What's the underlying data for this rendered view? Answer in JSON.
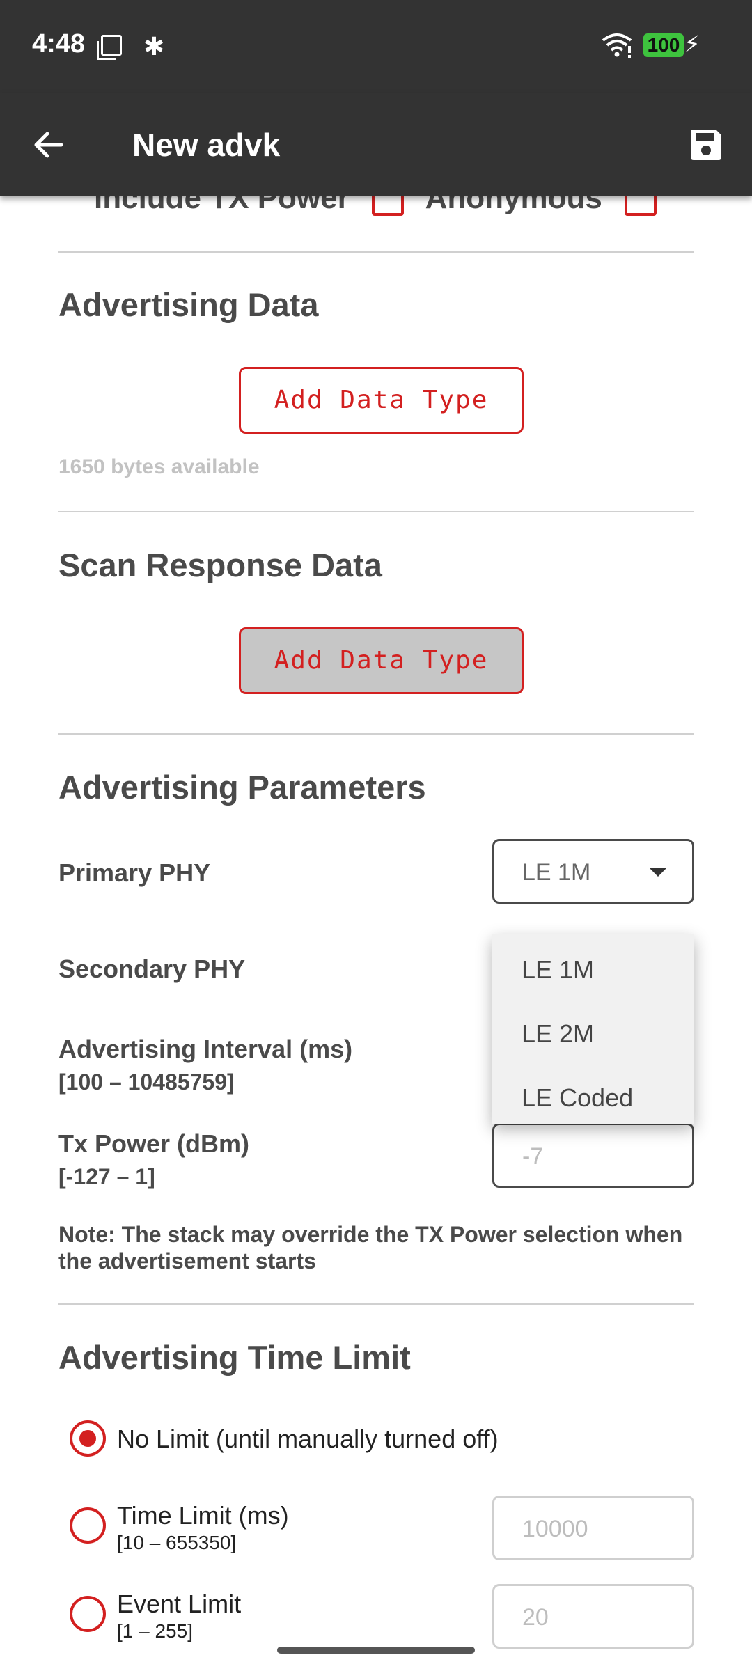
{
  "status_bar": {
    "time": "4:48",
    "battery": "100"
  },
  "app_bar": {
    "title": "New advk"
  },
  "top_partial": {
    "include_tx_label": "Include TX Power",
    "anonymous_label": "Anonymous"
  },
  "advertising_data": {
    "title": "Advertising Data",
    "button": "Add Data Type",
    "available": "1650 bytes available"
  },
  "scan_response": {
    "title": "Scan Response Data",
    "button": "Add Data Type"
  },
  "params": {
    "title": "Advertising Parameters",
    "primary_phy_label": "Primary PHY",
    "primary_phy_value": "LE 1M",
    "secondary_phy_label": "Secondary PHY",
    "interval_label": "Advertising Interval (ms)",
    "interval_range": "[100 – 10485759]",
    "tx_power_label": "Tx Power (dBm)",
    "tx_power_range": "[-127 – 1]",
    "tx_power_value": "-7",
    "note": "Note: The stack may override the TX Power selection when the advertisement starts"
  },
  "phy_options": [
    "LE 1M",
    "LE 2M",
    "LE Coded"
  ],
  "time_limit": {
    "title": "Advertising Time Limit",
    "no_limit_label": "No Limit (until manually turned off)",
    "time_limit_label": "Time Limit (ms)",
    "time_limit_range": "[10 – 655350]",
    "time_limit_placeholder": "10000",
    "event_limit_label": "Event Limit",
    "event_limit_range": "[1 – 255]",
    "event_limit_placeholder": "20"
  },
  "colors": {
    "accent": "#d32020",
    "bar": "#333333",
    "battery": "#3ec33e"
  },
  "icons": [
    "back-arrow-icon",
    "save-icon",
    "wifi-icon",
    "bluetooth-icon",
    "screen-icon",
    "charging-icon",
    "chevron-down-icon"
  ]
}
